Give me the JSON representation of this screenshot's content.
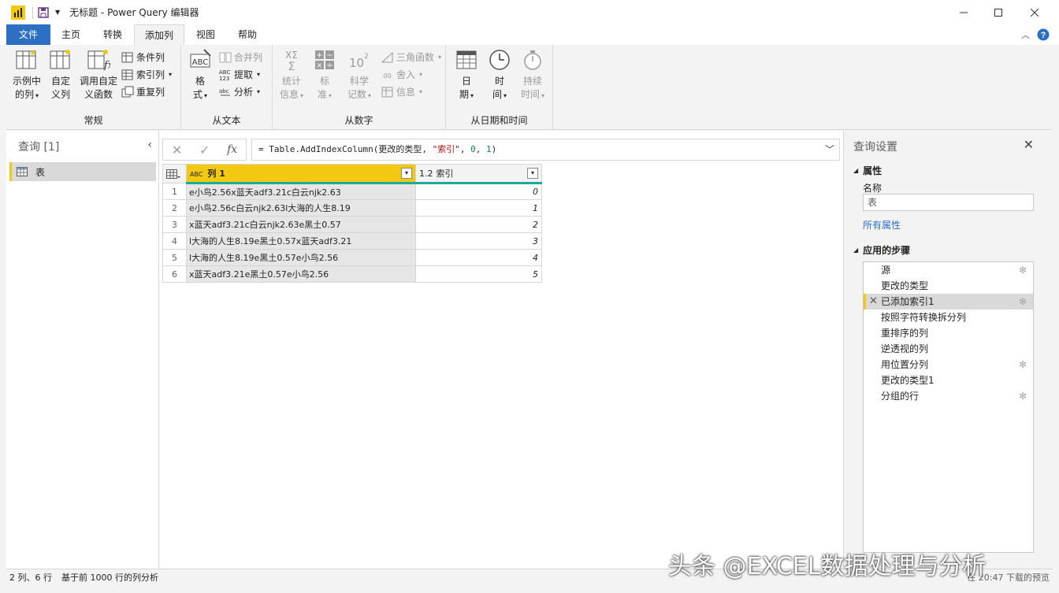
{
  "window": {
    "title": "无标题 - Power Query 编辑器"
  },
  "menu": {
    "tabs": [
      "文件",
      "主页",
      "转换",
      "添加列",
      "视图",
      "帮助"
    ],
    "active": "添加列"
  },
  "ribbon": {
    "general": {
      "group_label": "常规",
      "example_column": [
        "示例中",
        "的列"
      ],
      "custom_column": [
        "自定",
        "义列"
      ],
      "invoke_function": [
        "调用自定",
        "义函数"
      ],
      "conditional_column": "条件列",
      "index_column": "索引列",
      "duplicate_column": "重复列"
    },
    "text": {
      "group_label": "从文本",
      "format": [
        "格",
        "式"
      ],
      "merge_columns": "合并列",
      "extract": "提取",
      "parse": "分析"
    },
    "number": {
      "group_label": "从数字",
      "statistics": [
        "统计",
        "信息"
      ],
      "standard": [
        "标",
        "准"
      ],
      "scientific": [
        "科学",
        "记数"
      ],
      "trigonometry": "三角函数",
      "rounding": "舍入",
      "information": "信息"
    },
    "datetime": {
      "group_label": "从日期和时间",
      "date": [
        "日",
        "期"
      ],
      "time": [
        "时",
        "间"
      ],
      "duration": [
        "持续",
        "时间"
      ]
    }
  },
  "queries": {
    "header": "查询 [1]",
    "items": [
      "表"
    ]
  },
  "formula": {
    "prefix": "= Table.AddIndexColumn(更改的类型, ",
    "arg_string": "\"索引\"",
    "sep1": ", ",
    "arg_start": "0",
    "sep2": ", ",
    "arg_step": "1",
    "suffix": ")"
  },
  "table": {
    "col1_type": "ABC",
    "col1_name": "列 1",
    "col2_type": "1.2",
    "col2_name": "索引",
    "rows": [
      {
        "n": "1",
        "c1": "e小鸟2.56x蓝天adf3.21c白云njk2.63",
        "c2": "0"
      },
      {
        "n": "2",
        "c1": "e小鸟2.56c白云njk2.63l大海的人生8.19",
        "c2": "1"
      },
      {
        "n": "3",
        "c1": "x蓝天adf3.21c白云njk2.63e黑土0.57",
        "c2": "2"
      },
      {
        "n": "4",
        "c1": "l大海的人生8.19e黑土0.57x蓝天adf3.21",
        "c2": "3"
      },
      {
        "n": "5",
        "c1": "l大海的人生8.19e黑土0.57e小鸟2.56",
        "c2": "4"
      },
      {
        "n": "6",
        "c1": "x蓝天adf3.21e黑土0.57e小鸟2.56",
        "c2": "5"
      }
    ]
  },
  "settings": {
    "header": "查询设置",
    "properties_title": "属性",
    "name_label": "名称",
    "name_value": "表",
    "all_properties": "所有属性",
    "steps_title": "应用的步骤",
    "steps": [
      {
        "label": "源",
        "gear": true,
        "active": false
      },
      {
        "label": "更改的类型",
        "gear": false,
        "active": false
      },
      {
        "label": "已添加索引1",
        "gear": true,
        "active": true
      },
      {
        "label": "按照字符转换拆分列",
        "gear": false,
        "active": false
      },
      {
        "label": "重排序的列",
        "gear": false,
        "active": false
      },
      {
        "label": "逆透视的列",
        "gear": false,
        "active": false
      },
      {
        "label": "用位置分列",
        "gear": true,
        "active": false
      },
      {
        "label": "更改的类型1",
        "gear": false,
        "active": false
      },
      {
        "label": "分组的行",
        "gear": true,
        "active": false
      }
    ]
  },
  "status": {
    "counts": "2 列、6 行",
    "profiling": "基于前 1000 行的列分析",
    "preview": "在 20:47 下载的预览"
  },
  "watermark": "头条 @EXCEL数据处理与分析",
  "colors": {
    "accent_yellow": "#f2c811",
    "file_blue": "#2c6fc3",
    "quality_teal": "#1aab9b"
  }
}
